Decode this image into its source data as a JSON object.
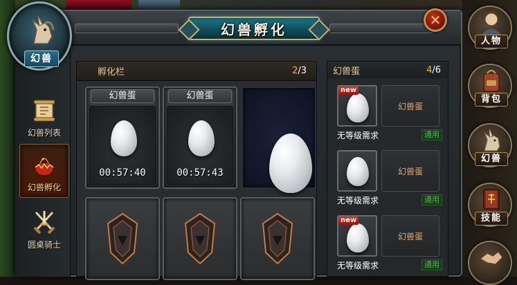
{
  "window": {
    "title": "幻兽孵化",
    "close_label": "✕"
  },
  "medallion": {
    "label": "幻兽"
  },
  "tabs": [
    {
      "label": "幻兽列表",
      "icon": "scroll-icon"
    },
    {
      "label": "幻兽孵化",
      "icon": "hatching-egg-icon",
      "active": true
    },
    {
      "label": "圆桌骑士",
      "icon": "crossed-swords-icon"
    }
  ],
  "hatch": {
    "title": "孵化栏",
    "count_current": "2",
    "count_total": "/3",
    "slots": [
      {
        "name": "幻兽蛋",
        "timer": "00:57:40"
      },
      {
        "name": "幻兽蛋",
        "timer": "00:57:43"
      }
    ]
  },
  "inventory": {
    "title": "幻兽蛋",
    "count_current": "4",
    "count_total": "/6",
    "items": [
      {
        "name": "幻兽蛋",
        "requirement": "无等级需求",
        "tag": "通用",
        "new": "new"
      },
      {
        "name": "幻兽蛋",
        "requirement": "无等级需求",
        "tag": "通用"
      },
      {
        "name": "幻兽蛋",
        "requirement": "无等级需求",
        "tag": "通用",
        "new": "new"
      }
    ]
  },
  "right_menu": [
    {
      "label": "人物",
      "icon": "character-portrait-icon"
    },
    {
      "label": "背包",
      "icon": "backpack-icon"
    },
    {
      "label": "幻兽",
      "icon": "unicorn-icon"
    },
    {
      "label": "技能",
      "icon": "skill-book-icon"
    },
    {
      "label": "",
      "icon": "handshake-icon"
    }
  ],
  "colors": {
    "accent_gold": "#e8c890",
    "highlight_orange": "#ffb030",
    "tag_green": "#40c040",
    "title_teal": "#1e7a8a"
  }
}
